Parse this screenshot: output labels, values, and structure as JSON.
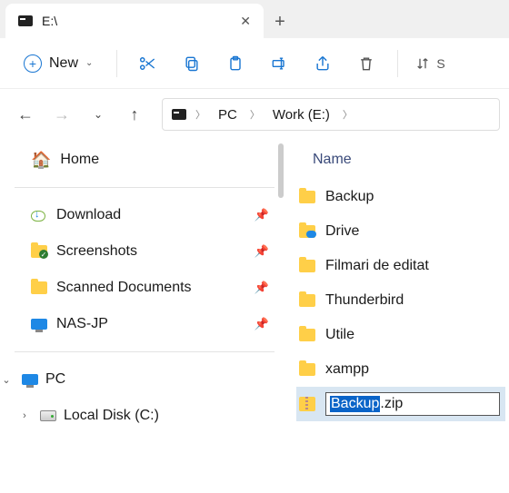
{
  "tab": {
    "title": "E:\\"
  },
  "toolbar": {
    "new_label": "New",
    "sort_partial": "S"
  },
  "breadcrumb": {
    "pc": "PC",
    "drive": "Work (E:)"
  },
  "sidebar": {
    "home": "Home",
    "quick": [
      {
        "label": "Download"
      },
      {
        "label": "Screenshots"
      },
      {
        "label": "Scanned Documents"
      },
      {
        "label": "NAS-JP"
      }
    ],
    "pc": "PC",
    "localdisk": "Local Disk (C:)"
  },
  "main": {
    "col_name": "Name",
    "items": [
      {
        "label": "Backup",
        "type": "folder"
      },
      {
        "label": "Drive",
        "type": "cloud"
      },
      {
        "label": "Filmari de editat",
        "type": "folder"
      },
      {
        "label": "Thunderbird",
        "type": "folder"
      },
      {
        "label": "Utile",
        "type": "folder"
      },
      {
        "label": "xampp",
        "type": "folder"
      }
    ],
    "rename": {
      "selected": "Backup",
      "rest": ".zip"
    }
  }
}
